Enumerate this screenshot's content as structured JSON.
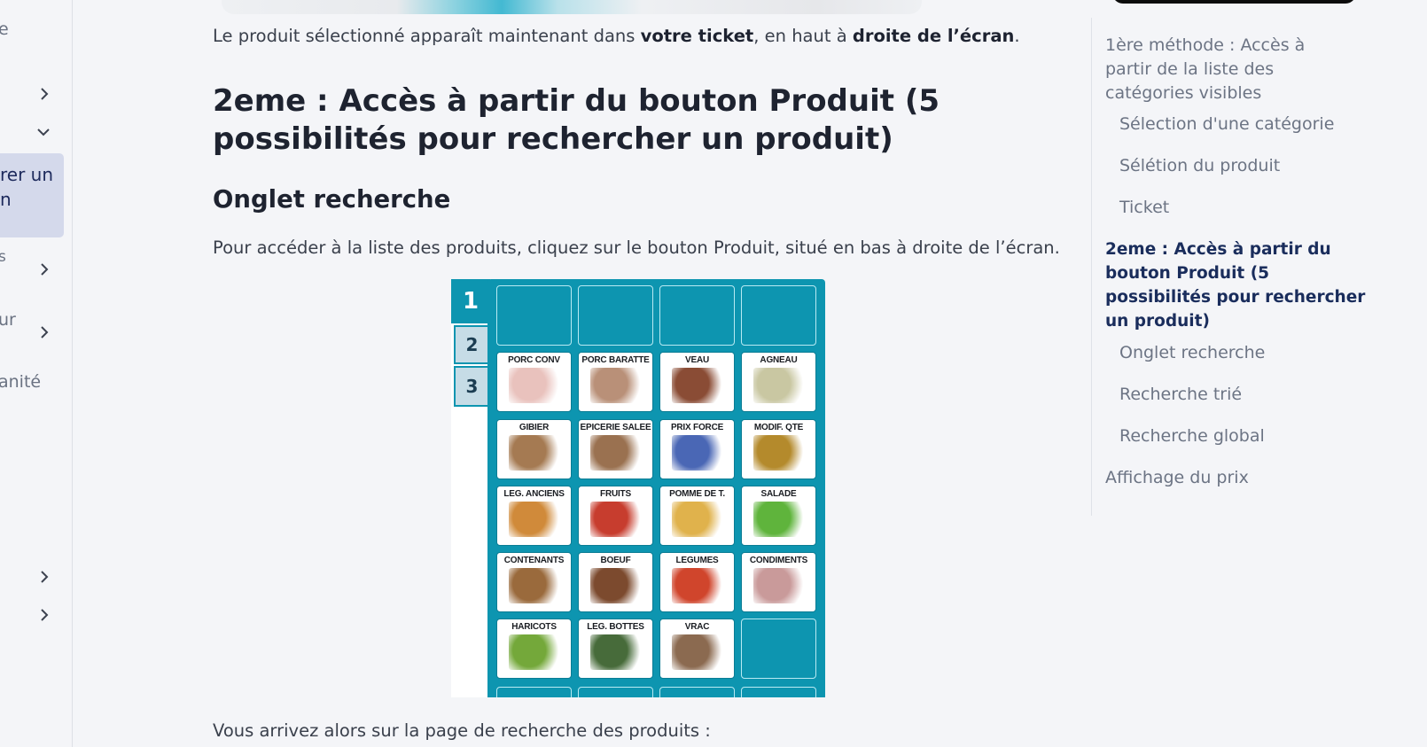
{
  "sidebar": {
    "fragments": [
      "e",
      "rer un\nn",
      "s",
      "ur",
      "anité"
    ]
  },
  "main": {
    "intro": {
      "before": "Le produit sélectionné apparaît maintenant dans ",
      "bold1": "votre ticket",
      "middle": ", en haut à ",
      "bold2": "droite de l’écran",
      "after": "."
    },
    "heading2": "2eme : Accès à partir du bouton Produit (5 possibilités pour rechercher un produit)",
    "heading3": "Onglet recherche",
    "paragraph": "Pour accéder à la liste des produits, cliquez sur le bouton Produit, situé en bas à droite de l’écran.",
    "bottom_text": "Vous arrivez alors sur la page de recherche des produits :"
  },
  "product_grid": {
    "tabs": [
      "1",
      "2",
      "3"
    ],
    "rows": [
      [
        {
          "label": "",
          "pic": ""
        },
        {
          "label": "",
          "pic": ""
        },
        {
          "label": "",
          "pic": ""
        },
        {
          "label": "",
          "pic": ""
        }
      ],
      [
        {
          "label": "PORC CONV",
          "pic": "pig-photo"
        },
        {
          "label": "PORC BARATTE",
          "pic": "pigs-photo"
        },
        {
          "label": "VEAU",
          "pic": "calf-photo"
        },
        {
          "label": "AGNEAU",
          "pic": "lamb-photo"
        }
      ],
      [
        {
          "label": "GIBIER",
          "pic": "game-birds-photo"
        },
        {
          "label": "EPICERIE SALEE",
          "pic": "grocery-photo"
        },
        {
          "label": "PRIX FORCE",
          "pic": "forced-price-icon"
        },
        {
          "label": "MODIF. QTE",
          "pic": "coins-photo"
        }
      ],
      [
        {
          "label": "LEG. ANCIENS",
          "pic": "squash-photo"
        },
        {
          "label": "FRUITS",
          "pic": "fruits-photo"
        },
        {
          "label": "POMME DE T.",
          "pic": "potatoes-photo"
        },
        {
          "label": "SALADE",
          "pic": "lettuce-photo"
        }
      ],
      [
        {
          "label": "CONTENANTS",
          "pic": "basket-photo"
        },
        {
          "label": "BOEUF",
          "pic": "cow-photo"
        },
        {
          "label": "LEGUMES",
          "pic": "vegetables-photo"
        },
        {
          "label": "CONDIMENTS",
          "pic": "onions-photo"
        }
      ],
      [
        {
          "label": "HARICOTS",
          "pic": "beans-photo"
        },
        {
          "label": "LEG. BOTTES",
          "pic": "bunched-veg-photo"
        },
        {
          "label": "VRAC",
          "pic": "bulk-jars-photo"
        },
        {
          "label": "",
          "pic": ""
        }
      ]
    ],
    "pic_colors": {
      "pig-photo": "#e9c2bd",
      "pigs-photo": "#b99078",
      "calf-photo": "#8a4c35",
      "lamb-photo": "#c9c7a2",
      "game-birds-photo": "#a57a52",
      "grocery-photo": "#9a7150",
      "forced-price-icon": "#4a67b5",
      "coins-photo": "#b48a2c",
      "squash-photo": "#d08a3a",
      "fruits-photo": "#c73d2e",
      "potatoes-photo": "#e0b24c",
      "lettuce-photo": "#5fb43c",
      "basket-photo": "#9a6a3c",
      "cow-photo": "#7c4a2e",
      "vegetables-photo": "#d0452c",
      "onions-photo": "#c99a9a",
      "beans-photo": "#74a83a",
      "bunched-veg-photo": "#476b3a",
      "bulk-jars-photo": "#8b6a50"
    }
  },
  "toc": {
    "items": [
      {
        "label": "1ère méthode : Accès à\npartir de la liste des\ncatégories visibles",
        "level": 1,
        "active": false
      },
      {
        "label": "Sélection d'une catégorie",
        "level": 2,
        "active": false
      },
      {
        "label": "Sélétion du produit",
        "level": 2,
        "active": false
      },
      {
        "label": "Ticket",
        "level": 2,
        "active": false
      },
      {
        "label": "2eme : Accès à partir du\nbouton Produit (5\npossibilités pour rechercher\nun produit)",
        "level": 1,
        "active": true
      },
      {
        "label": "Onglet recherche",
        "level": 2,
        "active": false
      },
      {
        "label": "Recherche trié",
        "level": 2,
        "active": false
      },
      {
        "label": "Recherche global",
        "level": 2,
        "active": false
      },
      {
        "label": "Affichage du prix",
        "level": 1,
        "active": false
      }
    ]
  },
  "colors": {
    "accent": "#0d95b0",
    "sidebar_active_bg": "#d4d9eb",
    "toc_active": "#1a2d5c"
  }
}
